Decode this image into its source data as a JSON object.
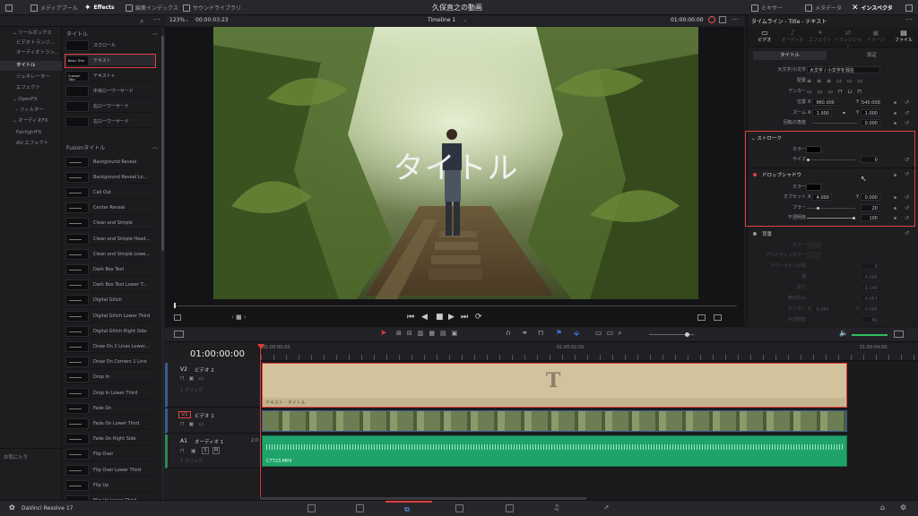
{
  "topbar": {
    "items": [
      "メディアプール",
      "Effects",
      "編集インデックス",
      "サウンドライブラリ"
    ],
    "title": "久保直之の動画",
    "right_items": [
      "ミキサー",
      "メタデータ",
      "インスペクタ"
    ]
  },
  "leftnav": {
    "items": [
      "ツールボックス",
      "ビデオトランジ...",
      "オーディオトラン...",
      "タイトル",
      "ジェネレーター",
      "エフェクト",
      "OpenFX",
      "フィルター",
      "オーディオFX",
      "FairlightFX",
      "AU エフェクト"
    ],
    "favorites": "お気に入り"
  },
  "effects": {
    "section1": "タイトル",
    "titles": [
      {
        "thumb": "",
        "label": "スクロール"
      },
      {
        "thumb": "Basic Title",
        "label": "テキスト"
      },
      {
        "thumb": "Custom Title",
        "label": "テキスト+"
      },
      {
        "thumb": "",
        "label": "中央ローワーサード"
      },
      {
        "thumb": "",
        "label": "右ローワーサード"
      },
      {
        "thumb": "",
        "label": "左ローワーサード"
      }
    ],
    "section2": "Fusionタイトル",
    "fusion": [
      "Background Reveal",
      "Background Reveal Lo...",
      "Call Out",
      "Center Reveal",
      "Clean and Simple",
      "Clean and Simple Head...",
      "Clean and Simple Lowe...",
      "Dark Box Text",
      "Dark Box Text Lower T...",
      "Digital Glitch",
      "Digital Glitch Lower Third",
      "Digital Glitch Right Side",
      "Draw On 2 Lines Lower...",
      "Draw On Corners 1 Line",
      "Drop In",
      "Drop In Lower Third",
      "Fade On",
      "Fade On Lower Third",
      "Fade On Right Side",
      "Flip Over",
      "Flip Over Lower Third",
      "Flip Up",
      "Flip Up Lower Third"
    ]
  },
  "viewer": {
    "zoom": "123%",
    "timecode_left": "00:00:03:23",
    "timeline_name": "Timeline 1",
    "timecode_right": "01:00:00:00",
    "title_overlay": "タイトル"
  },
  "inspector": {
    "header": "タイムライン - Title - テキスト",
    "tabs": [
      "ビデオ",
      "オーディオ",
      "エフェクト",
      "トランジション",
      "イメージ",
      "ファイル"
    ],
    "subtabs": [
      "タイトル",
      "設定"
    ],
    "case_label": "大文字/小文字",
    "case_value": "大文字 / 小文字を混在",
    "align_label": "配置",
    "anchor_label": "アンカー",
    "pos_label": "位置",
    "pos_x": "960.000",
    "pos_y": "540.000",
    "zoom_label": "ズーム",
    "zoom_x": "1.000",
    "zoom_y": "1.000",
    "rot_label": "回転の角度",
    "rot": "0.000",
    "stroke_title": "ストローク",
    "color_label": "カラー",
    "size_label": "サイズ",
    "stroke_size": "0",
    "shadow_title": "ドロップシャドウ",
    "offset_label": "オフセット",
    "shadow_x": "4.000",
    "shadow_y": "0.000",
    "blur_label": "ブラー",
    "blur": "20",
    "opacity_label": "不透明度",
    "opacity": "100",
    "bg_title": "背景",
    "bg_color_label": "カラー",
    "outline_color_label": "アウトラインカラー",
    "outline_width_label": "アウトラインの幅",
    "outline_width": "0",
    "width_label": "幅",
    "width": "0.000",
    "height_label": "高さ",
    "height": "0.140",
    "corner_label": "角の丸み",
    "corner": "0.057",
    "center_label": "センター",
    "center_x": "0.000",
    "center_y": "0.000",
    "bg_opacity_label": "不透明度",
    "bg_opacity": "60",
    "x": "X",
    "y": "Y"
  },
  "timeline": {
    "timecode": "01:00:00:00",
    "ruler": [
      "01:00:00:00",
      "01:00:02:00",
      "01:00:04:00"
    ],
    "tracks": [
      {
        "id": "V2",
        "name": "ビデオ 2",
        "sub": "1 クリップ"
      },
      {
        "id": "V1",
        "name": "ビデオ 1",
        "sub": ""
      },
      {
        "id": "A1",
        "name": "オーディオ 1",
        "level": "2.0",
        "sub": "1 クリップ"
      }
    ],
    "title_clip_label": "テキスト - タイトル",
    "title_glyph": "T",
    "audio_clip_label": "C7723.MP4",
    "s_btn": "S",
    "m_btn": "M"
  },
  "status": {
    "app": "DaVinci Resolve 17"
  },
  "colors": {
    "accent_red": "#e04040",
    "title_clip": "#d2c39c",
    "audio_clip": "#1fa36a",
    "playhead": "#e03a3a"
  }
}
